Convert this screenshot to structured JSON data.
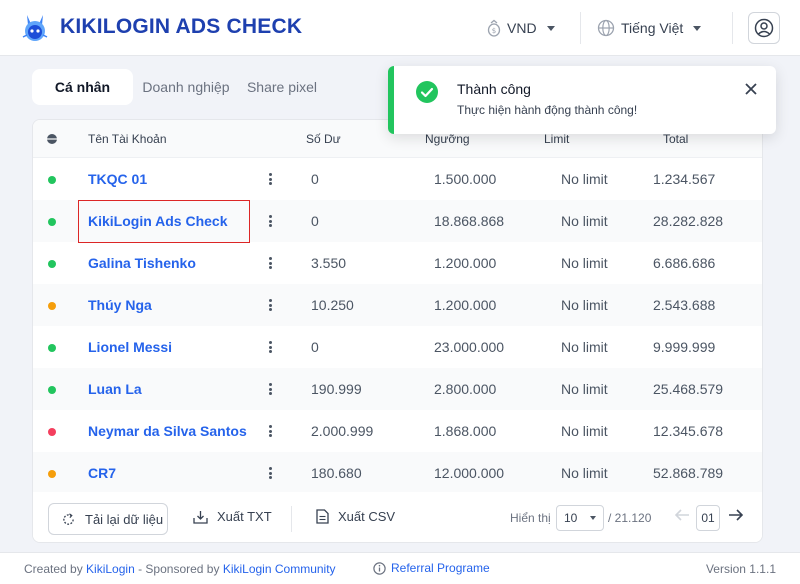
{
  "app": {
    "title": "KIKILOGIN ADS CHECK"
  },
  "header": {
    "currency": "VND",
    "language": "Tiếng Việt"
  },
  "tabs": [
    {
      "label": "Cá nhân",
      "active": true
    },
    {
      "label": "Doanh nghiệp",
      "active": false
    },
    {
      "label": "Share pixel",
      "active": false
    }
  ],
  "table": {
    "headers": {
      "name": "Tên Tài Khoản",
      "balance": "Số Dư",
      "threshold": "Ngưỡng",
      "limit": "Limit",
      "total": "Total"
    },
    "rows": [
      {
        "status": "#22c55e",
        "name": "TKQC 01",
        "balance": "0",
        "threshold": "1.500.000",
        "limit": "No limit",
        "total": "1.234.567"
      },
      {
        "status": "#22c55e",
        "name": "KikiLogin Ads Check",
        "balance": "0",
        "threshold": "18.868.868",
        "limit": "No limit",
        "total": "28.282.828"
      },
      {
        "status": "#22c55e",
        "name": "Galina Tishenko",
        "balance": "3.550",
        "threshold": "1.200.000",
        "limit": "No limit",
        "total": "6.686.686"
      },
      {
        "status": "#f59e0b",
        "name": "Thúy Nga",
        "balance": "10.250",
        "threshold": "1.200.000",
        "limit": "No limit",
        "total": "2.543.688"
      },
      {
        "status": "#22c55e",
        "name": "Lionel Messi",
        "balance": "0",
        "threshold": "23.000.000",
        "limit": "No limit",
        "total": "9.999.999"
      },
      {
        "status": "#22c55e",
        "name": "Luan La",
        "balance": "190.999",
        "threshold": "2.800.000",
        "limit": "No limit",
        "total": "25.468.579"
      },
      {
        "status": "#f43f5e",
        "name": "Neymar da Silva Santos",
        "balance": "2.000.999",
        "threshold": "1.868.000",
        "limit": "No limit",
        "total": "12.345.678"
      },
      {
        "status": "#f59e0b",
        "name": "CR7",
        "balance": "180.680",
        "threshold": "12.000.000",
        "limit": "No limit",
        "total": "52.868.789"
      }
    ]
  },
  "toolbar": {
    "reload": "Tải lại dữ liệu",
    "export_txt": "Xuất TXT",
    "export_csv": "Xuất CSV",
    "show_label": "Hiển thị",
    "page_size": "10",
    "total": "/ 21.120",
    "page": "01"
  },
  "footer": {
    "created_by": "Created by",
    "created_link": "KikiLogin",
    "sponsored_by": "- Sponsored by",
    "sponsored_link": "KikiLogin Community",
    "referral": "Referral Programe",
    "version": "Version 1.1.1"
  },
  "toast": {
    "title": "Thành công",
    "message": "Thực hiện hành động thành công!",
    "accent": "#22c55e"
  },
  "icons": {
    "logo": "bunny-logo-icon",
    "currency": "coin-icon",
    "language": "globe-icon",
    "user": "user-circle-icon",
    "reload": "refresh-icon",
    "export_txt": "download-icon",
    "export_csv": "file-icon",
    "referral": "info-icon",
    "toast": "check-circle-icon",
    "close": "close-icon"
  }
}
